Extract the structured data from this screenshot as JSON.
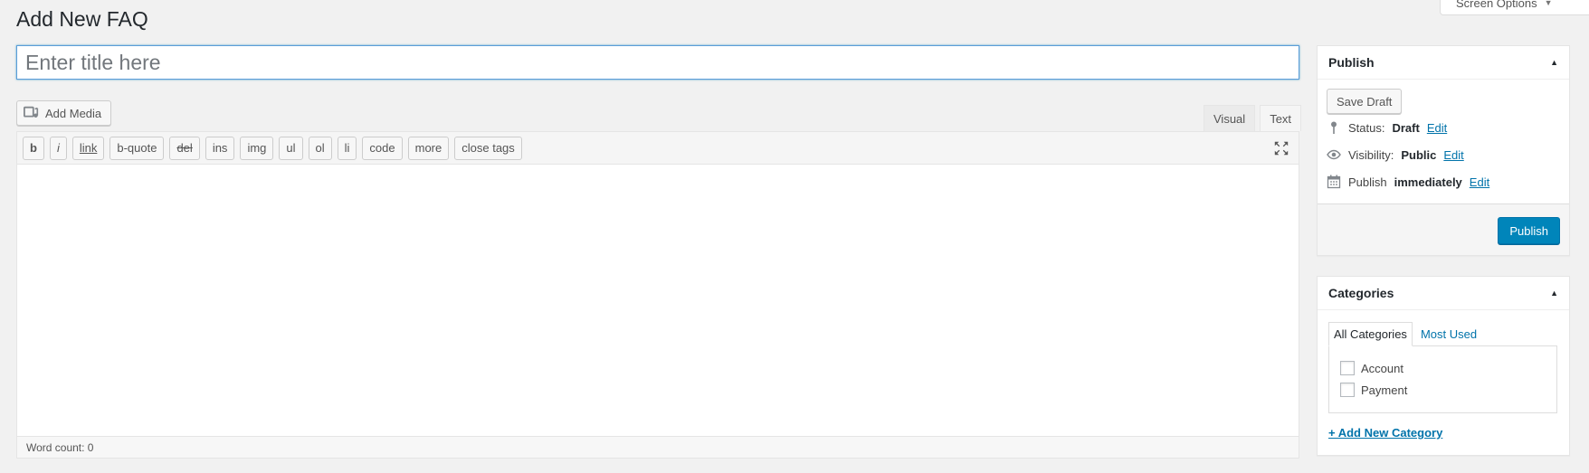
{
  "page": {
    "title": "Add New FAQ"
  },
  "screen_options": {
    "label": "Screen Options",
    "arrow": "▼"
  },
  "post_title": {
    "placeholder": "Enter title here",
    "value": ""
  },
  "media": {
    "add_media_label": "Add Media",
    "icon": "media-icon"
  },
  "editor_tabs": [
    {
      "label": "Visual"
    },
    {
      "label": "Text"
    }
  ],
  "quicktags": [
    "b",
    "i",
    "link",
    "b-quote",
    "del",
    "ins",
    "img",
    "ul",
    "ol",
    "li",
    "code",
    "more",
    "close tags"
  ],
  "editor": {
    "content": "",
    "word_count_label": "Word count: 0"
  },
  "publish_box": {
    "title": "Publish",
    "toggle": "▲",
    "save_draft_label": "Save Draft",
    "status_label": "Status:",
    "status_value": "Draft",
    "visibility_label": "Visibility:",
    "visibility_value": "Public",
    "publish_label": "Publish",
    "publish_value": "immediately",
    "edit_label": "Edit",
    "publish_button_label": "Publish"
  },
  "categories_box": {
    "title": "Categories",
    "toggle": "▲",
    "tab_all": "All Categories",
    "tab_most_used": "Most Used",
    "items": [
      {
        "label": "Account",
        "checked": false
      },
      {
        "label": "Payment",
        "checked": false
      }
    ],
    "add_new_label": "+ Add New Category"
  },
  "colors": {
    "accent": "#0073aa",
    "primary_button": "#0085ba",
    "background": "#f1f1f1"
  }
}
